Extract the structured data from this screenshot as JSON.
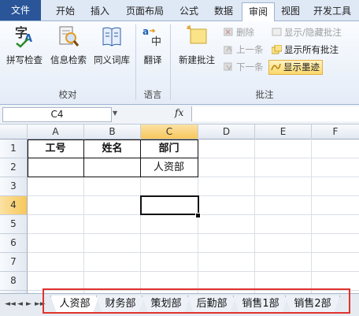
{
  "ribbon_tabs": [
    "文件",
    "开始",
    "插入",
    "页面布局",
    "公式",
    "数据",
    "审阅",
    "视图",
    "开发工具"
  ],
  "active_tab": "审阅",
  "proofing": {
    "spell_check": "拼写检查",
    "research": "信息检索",
    "thesaurus": "同义词库",
    "label": "校对"
  },
  "language": {
    "translate": "翻译",
    "label": "语言"
  },
  "comments": {
    "new_comment": "新建批注",
    "delete": "删除",
    "previous": "上一条",
    "next": "下一条",
    "show_hide": "显示/隐藏批注",
    "show_all": "显示所有批注",
    "show_ink": "显示墨迹",
    "label": "批注"
  },
  "formula_bar": {
    "name_box": "C4",
    "fx": "fx",
    "formula": ""
  },
  "columns": [
    "A",
    "B",
    "C",
    "D",
    "E",
    "F"
  ],
  "rows": [
    "1",
    "2",
    "3",
    "4",
    "5",
    "6",
    "7",
    "8",
    "9"
  ],
  "cells": {
    "A1": "工号",
    "B1": "姓名",
    "C1": "部门",
    "C2": "人资部"
  },
  "sheets": [
    "人资部",
    "财务部",
    "策划部",
    "后勤部",
    "销售1部",
    "销售2部"
  ],
  "sheet_nav": [
    "◄◄",
    "◄",
    "►",
    "►►"
  ],
  "colors": {
    "file_tab": "#2a5699",
    "highlight": "#e0322d",
    "selected_header": "#f7c75b"
  }
}
